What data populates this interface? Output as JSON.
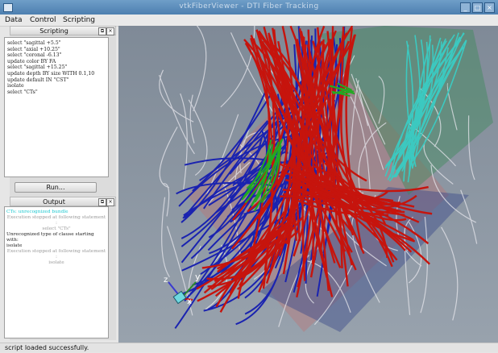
{
  "window": {
    "title": "vtkFiberViewer - DTI Fiber Tracking"
  },
  "menubar": {
    "items": [
      "Data",
      "Control",
      "Scripting"
    ]
  },
  "scripting_panel": {
    "title": "Scripting",
    "script_lines": [
      "select \"sagittal +5.5\"",
      "select \"axial +10.25\"",
      "select \"coronal -6.13\"",
      "update color BY FA",
      "select \"sagittal +15.25\"",
      "update depth BY size WITH 0.1,10",
      "update default IN \"CST\"",
      "",
      "isolate",
      "select \"CTs\""
    ],
    "run_label": "Run..."
  },
  "output_panel": {
    "title": "Output",
    "lines": [
      {
        "text": "CTs: unrecognized bundle",
        "color": "#1ec8d0",
        "align": "left"
      },
      {
        "text": "Execution stopped at following statement :",
        "color": "#9a9a9a",
        "align": "center"
      },
      {
        "text": "select \"CTs\"",
        "color": "#9a9a9a",
        "align": "center"
      },
      {
        "text": "Unrecognized type of clause starting with:",
        "color": "#222222",
        "align": "left"
      },
      {
        "text": "isolate",
        "color": "#222222",
        "align": "left"
      },
      {
        "text": "Execution stopped at following statement :",
        "color": "#9a9a9a",
        "align": "center"
      },
      {
        "text": "isolate",
        "color": "#9a9a9a",
        "align": "center"
      }
    ]
  },
  "axes_labels": {
    "x": "x",
    "y": "y",
    "z": "z"
  },
  "colors": {
    "viewport_bg": "#8c97a3",
    "fiber_red": "#c8140c",
    "fiber_blue": "#1822a8",
    "fiber_cyan": "#38c4bc",
    "fiber_green": "#20a020",
    "fiber_white": "#e8e8ec"
  },
  "status": {
    "text": "script loaded successfully."
  }
}
